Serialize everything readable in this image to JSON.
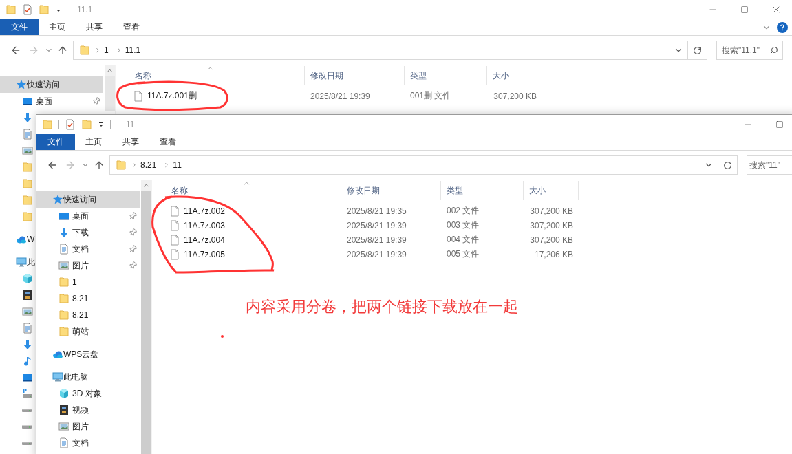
{
  "windows": [
    {
      "title": "11.1",
      "tabs": [
        {
          "label": "文件",
          "kind": "menu"
        },
        {
          "label": "主页",
          "kind": "tab"
        },
        {
          "label": "共享",
          "kind": "tab"
        },
        {
          "label": "查看",
          "kind": "tab"
        }
      ],
      "address": {
        "segments": [
          "1",
          "11.1"
        ]
      },
      "search": {
        "placeholder": "搜索\"11.1\""
      },
      "nav": [
        {
          "label": "快速访问",
          "kind": "quick-access",
          "selected": true,
          "children": [
            {
              "label": "桌面",
              "kind": "desktop",
              "pinned": true,
              "selected": false
            },
            {
              "kind": "download",
              "selected": false
            },
            {
              "kind": "documents",
              "selected": false
            },
            {
              "kind": "pictures",
              "selected": false
            },
            {
              "kind": "folder",
              "selected": false
            },
            {
              "kind": "folder",
              "selected": false
            },
            {
              "kind": "folder",
              "selected": false
            },
            {
              "kind": "folder",
              "selected": false
            }
          ]
        },
        {
          "label": "W",
          "kind": "cloud",
          "selected": false
        },
        {
          "label": "此",
          "kind": "pc",
          "selected": false,
          "children": [
            {
              "kind": "cube",
              "selected": false
            },
            {
              "kind": "video",
              "selected": false
            },
            {
              "kind": "pictures",
              "selected": false
            },
            {
              "kind": "documents",
              "selected": false
            },
            {
              "kind": "download",
              "selected": false
            },
            {
              "kind": "music",
              "selected": false
            },
            {
              "kind": "desktop",
              "selected": false
            },
            {
              "kind": "drive-windows",
              "selected": false
            },
            {
              "kind": "drive",
              "selected": false
            },
            {
              "kind": "drive",
              "selected": false
            },
            {
              "kind": "drive",
              "selected": false
            }
          ]
        }
      ],
      "columns": [
        {
          "label": "名称",
          "sorted": true
        },
        {
          "label": "修改日期",
          "sorted": false
        },
        {
          "label": "类型",
          "sorted": false
        },
        {
          "label": "大小",
          "sorted": false
        }
      ],
      "files": [
        {
          "name": "11A.7z.001删",
          "date": "2025/8/21 19:39",
          "type": "001删 文件",
          "size": "307,200 KB"
        }
      ]
    },
    {
      "title": "11",
      "tabs": [
        {
          "label": "文件",
          "kind": "menu"
        },
        {
          "label": "主页",
          "kind": "tab"
        },
        {
          "label": "共享",
          "kind": "tab"
        },
        {
          "label": "查看",
          "kind": "tab"
        }
      ],
      "address": {
        "segments": [
          "8.21",
          "11"
        ]
      },
      "search": {
        "placeholder": "搜索\"11\""
      },
      "nav": [
        {
          "label": "快速访问",
          "kind": "quick-access",
          "selected": true,
          "children": [
            {
              "label": "桌面",
              "kind": "desktop",
              "pinned": true,
              "selected": false
            },
            {
              "label": "下载",
              "kind": "download",
              "pinned": true,
              "selected": false
            },
            {
              "label": "文档",
              "kind": "documents",
              "pinned": true,
              "selected": false
            },
            {
              "label": "图片",
              "kind": "pictures",
              "pinned": true,
              "selected": false
            },
            {
              "label": "1",
              "kind": "folder",
              "pinned": false,
              "selected": false
            },
            {
              "label": "8.21",
              "kind": "folder",
              "pinned": false,
              "selected": false
            },
            {
              "label": "8.21",
              "kind": "folder",
              "pinned": false,
              "selected": false
            },
            {
              "label": "萌站",
              "kind": "folder",
              "pinned": false,
              "selected": false
            }
          ]
        },
        {
          "label": "WPS云盘",
          "kind": "cloud",
          "selected": false
        },
        {
          "label": "此电脑",
          "kind": "pc",
          "selected": false,
          "children": [
            {
              "label": "3D 对象",
              "kind": "cube",
              "selected": false
            },
            {
              "label": "视频",
              "kind": "video",
              "selected": false
            },
            {
              "label": "图片",
              "kind": "pictures",
              "selected": false
            },
            {
              "label": "文档",
              "kind": "documents",
              "selected": false
            }
          ]
        }
      ],
      "columns": [
        {
          "label": "名称",
          "sorted": true
        },
        {
          "label": "修改日期",
          "sorted": false
        },
        {
          "label": "类型",
          "sorted": false
        },
        {
          "label": "大小",
          "sorted": false
        }
      ],
      "files": [
        {
          "name": "11A.7z.002",
          "date": "2025/8/21 19:35",
          "type": "002 文件",
          "size": "307,200 KB"
        },
        {
          "name": "11A.7z.003",
          "date": "2025/8/21 19:39",
          "type": "003 文件",
          "size": "307,200 KB"
        },
        {
          "name": "11A.7z.004",
          "date": "2025/8/21 19:39",
          "type": "004 文件",
          "size": "307,200 KB"
        },
        {
          "name": "11A.7z.005",
          "date": "2025/8/21 19:39",
          "type": "005 文件",
          "size": "17,206 KB"
        }
      ]
    }
  ],
  "annotation": {
    "note": "内容采用分卷，把两个链接下载放在一起"
  }
}
